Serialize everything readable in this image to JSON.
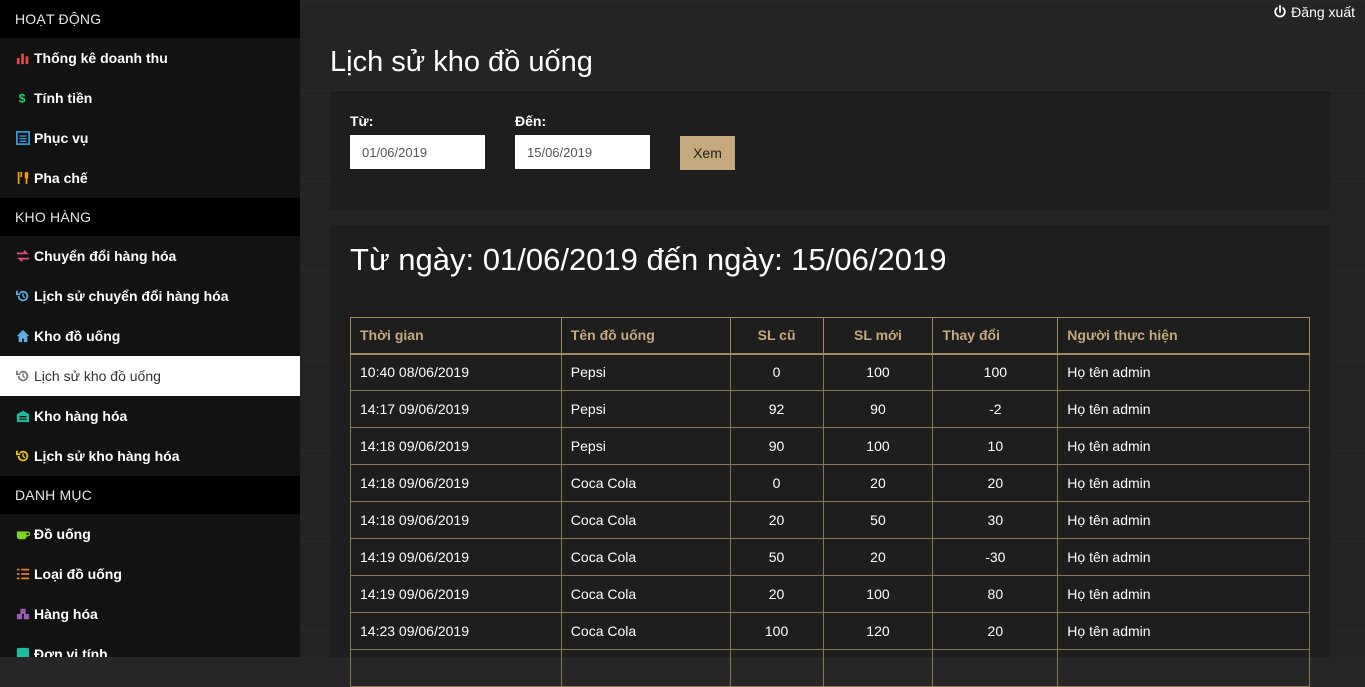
{
  "sidebar": {
    "sections": [
      {
        "title": "HOẠT ĐỘNG",
        "items": [
          {
            "label": "Thống kê doanh thu",
            "icon": "bar-chart-icon",
            "color": "#e74c3c"
          },
          {
            "label": "Tính tiền",
            "icon": "dollar-icon",
            "color": "#2ecc71"
          },
          {
            "label": "Phục vụ",
            "icon": "list-icon",
            "color": "#3498db"
          },
          {
            "label": "Pha chế",
            "icon": "utensils-icon",
            "color": "#f39c12"
          }
        ]
      },
      {
        "title": "KHO HÀNG",
        "items": [
          {
            "label": "Chuyển đổi hàng hóa",
            "icon": "exchange-icon",
            "color": "#e84a7f"
          },
          {
            "label": "Lịch sử chuyển đổi hàng hóa",
            "icon": "history-icon",
            "color": "#5dade2"
          },
          {
            "label": "Kho đồ uống",
            "icon": "home-icon",
            "color": "#5dade2"
          },
          {
            "label": "Lịch sử kho đồ uống",
            "icon": "history-icon",
            "color": "#777777",
            "active": true
          },
          {
            "label": "Kho hàng hóa",
            "icon": "warehouse-icon",
            "color": "#1abc9c"
          },
          {
            "label": "Lịch sử kho hàng hóa",
            "icon": "history-icon",
            "color": "#f1c40f"
          }
        ]
      },
      {
        "title": "DANH MỤC",
        "items": [
          {
            "label": "Đồ uống",
            "icon": "coffee-icon",
            "color": "#7ed321"
          },
          {
            "label": "Loại đồ uống",
            "icon": "list-ul-icon",
            "color": "#e67e22"
          },
          {
            "label": "Hàng hóa",
            "icon": "boxes-icon",
            "color": "#9b59b6"
          },
          {
            "label": "Đơn vị tính",
            "icon": "unit-icon",
            "color": "#1abc9c"
          }
        ]
      }
    ]
  },
  "header": {
    "logout_label": "Đăng xuất",
    "page_title": "Lịch sử kho đồ uống"
  },
  "filter": {
    "from_label": "Từ:",
    "from_value": "01/06/2019",
    "to_label": "Đến:",
    "to_value": "15/06/2019",
    "view_button": "Xem"
  },
  "result": {
    "title": "Từ ngày: 01/06/2019 đến ngày: 15/06/2019",
    "columns": [
      "Thời gian",
      "Tên đồ uống",
      "SL cũ",
      "SL mới",
      "Thay đổi",
      "Người thực hiện"
    ],
    "rows": [
      [
        "10:40 08/06/2019",
        "Pepsi",
        "0",
        "100",
        "100",
        "Họ tên admin"
      ],
      [
        "14:17 09/06/2019",
        "Pepsi",
        "92",
        "90",
        "-2",
        "Họ tên admin"
      ],
      [
        "14:18 09/06/2019",
        "Pepsi",
        "90",
        "100",
        "10",
        "Họ tên admin"
      ],
      [
        "14:18 09/06/2019",
        "Coca Cola",
        "0",
        "20",
        "20",
        "Họ tên admin"
      ],
      [
        "14:18 09/06/2019",
        "Coca Cola",
        "20",
        "50",
        "30",
        "Họ tên admin"
      ],
      [
        "14:19 09/06/2019",
        "Coca Cola",
        "50",
        "20",
        "-30",
        "Họ tên admin"
      ],
      [
        "14:19 09/06/2019",
        "Coca Cola",
        "20",
        "100",
        "80",
        "Họ tên admin"
      ],
      [
        "14:23 09/06/2019",
        "Coca Cola",
        "100",
        "120",
        "20",
        "Họ tên admin"
      ],
      [
        "",
        "",
        "",
        "",
        "",
        ""
      ]
    ]
  },
  "colors": {
    "accent": "#c4a97e",
    "sidebar_bg": "#121212",
    "main_bg": "#242424"
  }
}
